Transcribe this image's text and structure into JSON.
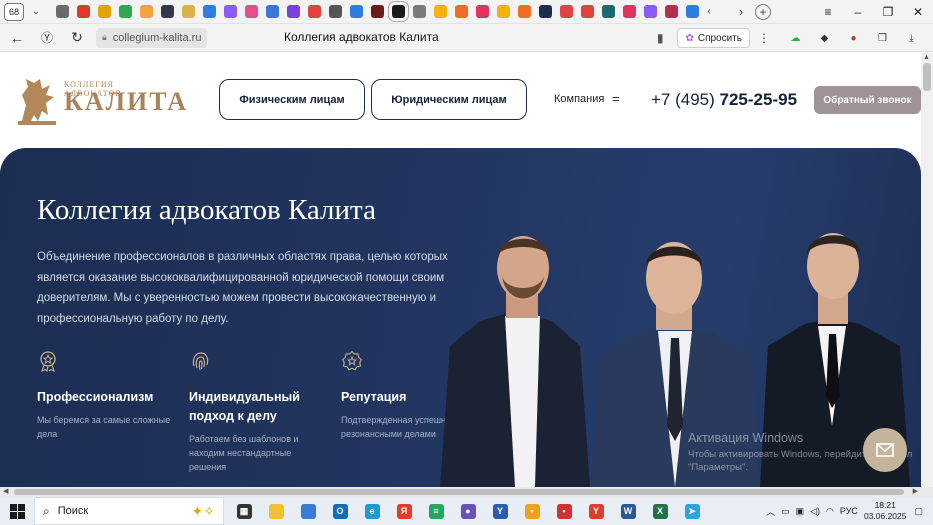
{
  "browser": {
    "tab_count": "68",
    "page_title": "Коллегия адвокатов Калита",
    "url": "collegium-kalita.ru",
    "ask_button": "Спросить",
    "favicons": [
      {
        "name": "tab-favicon",
        "color": "#6b6b6b"
      },
      {
        "name": "tab-favicon",
        "color": "#e0382b"
      },
      {
        "name": "tab-favicon",
        "color": "#e0a600"
      },
      {
        "name": "tab-favicon",
        "color": "#2fa84f"
      },
      {
        "name": "tab-favicon",
        "color": "#f2a33a"
      },
      {
        "name": "tab-favicon",
        "color": "#2f3a4c"
      },
      {
        "name": "tab-favicon",
        "color": "#d8b24a"
      },
      {
        "name": "tab-favicon",
        "color": "#2f7de1"
      },
      {
        "name": "tab-favicon",
        "color": "#8b5cf6"
      },
      {
        "name": "tab-favicon",
        "color": "#ea4b8b"
      },
      {
        "name": "tab-favicon",
        "color": "#3d77d6"
      },
      {
        "name": "tab-favicon",
        "color": "#7b3fe4"
      },
      {
        "name": "tab-favicon",
        "color": "#e44242"
      },
      {
        "name": "tab-favicon",
        "color": "#555555"
      },
      {
        "name": "tab-favicon",
        "color": "#2f7de1"
      },
      {
        "name": "tab-favicon",
        "color": "#6a1b1b"
      },
      {
        "name": "tab-favicon",
        "color": "#1a1a1a"
      },
      {
        "name": "tab-favicon",
        "color": "#7a7a7a"
      },
      {
        "name": "tab-favicon",
        "color": "#f2b40a"
      },
      {
        "name": "tab-favicon",
        "color": "#f06a2a"
      },
      {
        "name": "tab-favicon",
        "color": "#e2335f"
      },
      {
        "name": "tab-favicon",
        "color": "#f2b40a"
      },
      {
        "name": "tab-favicon",
        "color": "#f06a2a"
      },
      {
        "name": "tab-favicon",
        "color": "#1c2d4f"
      },
      {
        "name": "tab-favicon",
        "color": "#e44242"
      },
      {
        "name": "tab-favicon",
        "color": "#e44242"
      },
      {
        "name": "tab-favicon",
        "color": "#20666d"
      },
      {
        "name": "tab-favicon",
        "color": "#e2335f"
      },
      {
        "name": "tab-favicon",
        "color": "#8b5cf6"
      },
      {
        "name": "tab-favicon",
        "color": "#b03050"
      },
      {
        "name": "tab-favicon",
        "color": "#2f7de1"
      }
    ]
  },
  "site": {
    "logo_small": "КОЛЛЕГИЯ АДВОКАТОВ",
    "logo_big": "КАЛИТА",
    "nav_individuals": "Физическим лицам",
    "nav_legal": "Юридическим лицам",
    "company": "Компания",
    "phone_prefix": "+7 (495) ",
    "phone_main": "725-25-95",
    "callback": "Обратный звонок"
  },
  "hero": {
    "title": "Коллегия адвокатов Калита",
    "description": "Объединение профессионалов в различных областях права, целью которых является оказание высококвалифицированной юридической помощи своим доверителям. Мы с уверенностью можем провести высококачественную и профессиональную работу по делу.",
    "features": [
      {
        "title": "Профессионализм",
        "text": "Мы беремся за самые сложные дела"
      },
      {
        "title": "Индивидуальный подход к делу",
        "text": "Работаем без шаблонов и находим нестандартные решения"
      },
      {
        "title": "Репутация",
        "text": "Подтвержденная успешными и резонансными делами"
      }
    ]
  },
  "watermark": {
    "line1": "Активация Windows",
    "line2": "Чтобы активировать Windows, перейдите в раздел \"Параметры\"."
  },
  "taskbar": {
    "search_placeholder": "Поиск",
    "language": "РУС",
    "time": "18:21",
    "date": "03.06.2025",
    "apps": [
      {
        "name": "task-view-icon",
        "color": "#333333",
        "glyph": "▦"
      },
      {
        "name": "file-explorer-icon",
        "color": "#f2c12e",
        "glyph": ""
      },
      {
        "name": "store-icon",
        "color": "#3a7bd5",
        "glyph": ""
      },
      {
        "name": "outlook-icon",
        "color": "#0f6cbd",
        "glyph": "O"
      },
      {
        "name": "edge-icon",
        "color": "#1a9ad6",
        "glyph": "e"
      },
      {
        "name": "yandex-icon",
        "color": "#e23b2a",
        "glyph": "Я"
      },
      {
        "name": "spreadsheet-app-icon",
        "color": "#25a55f",
        "glyph": "≡"
      },
      {
        "name": "game-icon",
        "color": "#6b4fbb",
        "glyph": "●"
      },
      {
        "name": "yandex-browser-y-icon",
        "color": "#2a5db0",
        "glyph": "Y"
      },
      {
        "name": "messenger-icon",
        "color": "#f0a21a",
        "glyph": "•"
      },
      {
        "name": "app-red-icon",
        "color": "#d32f2f",
        "glyph": "▪"
      },
      {
        "name": "yandex-browser-icon",
        "color": "#e23b2a",
        "glyph": "Y"
      },
      {
        "name": "word-icon",
        "color": "#2b579a",
        "glyph": "W"
      },
      {
        "name": "excel-icon",
        "color": "#217346",
        "glyph": "X"
      },
      {
        "name": "telegram-icon",
        "color": "#2aa3e0",
        "glyph": "➤"
      }
    ]
  },
  "colors": {
    "navy": "#1c2d52",
    "gold": "#a9825a",
    "callback_bg": "#9e9398"
  }
}
